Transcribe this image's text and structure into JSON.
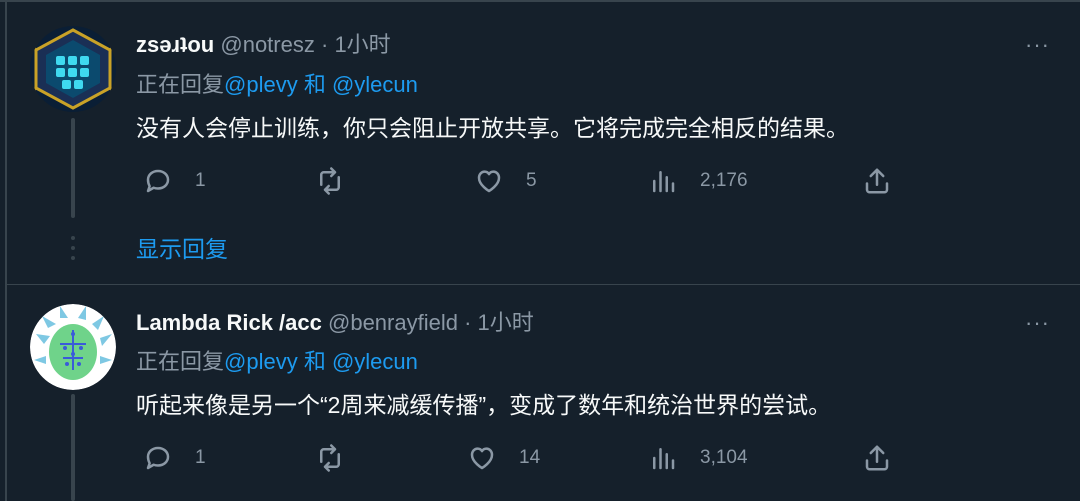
{
  "tweets": [
    {
      "name": "zsəɹʇou",
      "handle": "@notresz",
      "sep": "·",
      "time": "1小时",
      "more": "···",
      "replying_prefix": "正在回复",
      "mention1": "@plevy",
      "and": " 和 ",
      "mention2": "@ylecun",
      "text": "没有人会停止训练，你只会阻止开放共享。它将完成完全相反的结果。",
      "replies": "1",
      "retweets": "",
      "likes": "5",
      "views": "2,176",
      "icons": [
        "reply-icon",
        "retweet-icon",
        "like-icon",
        "views-icon",
        "share-icon"
      ]
    },
    {
      "name": "Lambda Rick /acc",
      "handle": "@benrayfield",
      "sep": "·",
      "time": "1小时",
      "more": "···",
      "replying_prefix": "正在回复",
      "mention1": "@plevy",
      "and": " 和 ",
      "mention2": "@ylecun",
      "text": "听起来像是另一个“2周来减缓传播”，变成了数年和统治世界的尝试。",
      "replies": "1",
      "retweets": "",
      "likes": "14",
      "views": "3,104",
      "icons": [
        "reply-icon",
        "retweet-icon",
        "like-icon",
        "views-icon",
        "share-icon"
      ]
    }
  ],
  "show_replies": "显示回复",
  "colors": {
    "background": "#15202b",
    "accent": "#1d9bf0",
    "muted": "#8b98a5",
    "border": "#38444d"
  }
}
